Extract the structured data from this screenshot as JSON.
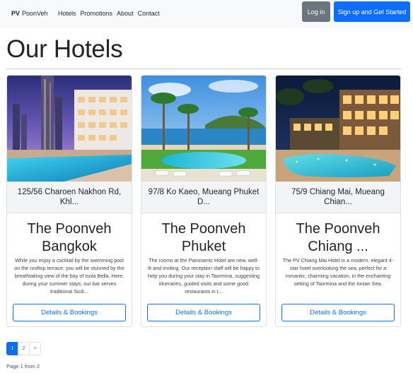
{
  "nav": {
    "brand_bold": "PV",
    "brand_name": "PoonVeh",
    "links": [
      "Hotels",
      "Promotions",
      "About",
      "Contact"
    ],
    "login_label": "Log in",
    "signup_label": "Sign up and Get Started"
  },
  "page": {
    "title": "Our Hotels"
  },
  "hotels": [
    {
      "address": "125/56 Charoen Nakhon Rd, Khl...",
      "name": "The Poonveh Bangkok",
      "description": "While you enjoy a cocktail by the swimming pool on the rooftop terrace, you will be stunned by the breathtaking view of the bay of Isola Bella. Here, during your summer stays, our bar serves traditional Sicili...",
      "button_label": "Details & Bookings"
    },
    {
      "address": "97/8 Ko Kaeo, Mueang Phuket D...",
      "name": "The Poonveh Phuket",
      "description": "The rooms at the Panoramic Hotel are new, well-lit and inviting. Our reception staff will be happy to help you during your stay in Taormina, suggesting itineraries, guided visits and some good restaurants in t...",
      "button_label": "Details & Bookings"
    },
    {
      "address": "75/9 Chiang Mai, Mueang Chian...",
      "name": "The Poonveh Chiang ...",
      "description": "The PV Chiang Mai Hotel is a modern, elegant 4-star hotel overlooking the sea, perfect for a romantic, charming vacation, in the enchanting setting of Taormina and the Ionian Sea.",
      "button_label": "Details & Bookings"
    }
  ],
  "pagination": {
    "pages": [
      "1",
      "2",
      ">"
    ],
    "current": "1",
    "info": "Page 1 from 2"
  },
  "colors": {
    "primary": "#0d6efd",
    "secondary": "#6c757d",
    "navbar_bg": "#f8f9fa"
  }
}
